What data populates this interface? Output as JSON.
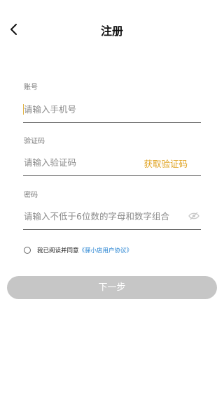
{
  "header": {
    "title": "注册",
    "back_icon": "chevron-left-icon"
  },
  "account": {
    "label": "账号",
    "placeholder": "请输入手机号"
  },
  "verify": {
    "label": "验证码",
    "placeholder": "请输入验证码",
    "get_code_label": "获取验证码"
  },
  "password": {
    "label": "密码",
    "placeholder": "请输入不低于6位数的字母和数字组合",
    "visibility_icon": "eye-off-icon"
  },
  "agreement": {
    "prefix": "我已阅读并同意",
    "link": "《驿小店用户协议》"
  },
  "next_button": {
    "label": "下一步"
  },
  "colors": {
    "accent": "#e0a321",
    "link": "#1f7fd0",
    "button_disabled": "#c6c6c6",
    "cursor": "#e0b140"
  }
}
